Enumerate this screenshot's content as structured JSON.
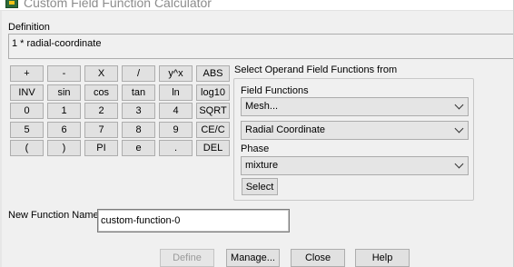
{
  "window": {
    "title": "Custom Field Function Calculator"
  },
  "definition": {
    "label": "Definition",
    "value": "1 * radial-coordinate"
  },
  "keypad": {
    "rows": [
      [
        "+",
        "-",
        "X",
        "/",
        "y^x",
        "ABS"
      ],
      [
        "INV",
        "sin",
        "cos",
        "tan",
        "ln",
        "log10"
      ],
      [
        "0",
        "1",
        "2",
        "3",
        "4",
        "SQRT"
      ],
      [
        "5",
        "6",
        "7",
        "8",
        "9",
        "CE/C"
      ],
      [
        "(",
        ")",
        "PI",
        "e",
        ".",
        "DEL"
      ]
    ]
  },
  "operand": {
    "heading": "Select Operand Field Functions from",
    "field_functions_label": "Field Functions",
    "category_value": "Mesh...",
    "function_value": "Radial Coordinate",
    "phase_label": "Phase",
    "phase_value": "mixture",
    "select_label": "Select"
  },
  "new_function": {
    "label": "New Function Name",
    "value": "custom-function-0"
  },
  "actions": {
    "define": "Define",
    "manage": "Manage...",
    "close": "Close",
    "help": "Help"
  }
}
